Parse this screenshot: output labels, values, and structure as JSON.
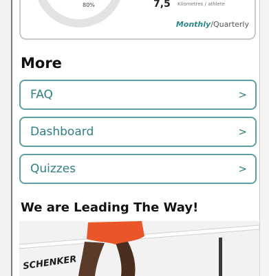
{
  "stats": {
    "ring_percent_label": "80%",
    "value": "7,5",
    "unit": "Kilometres / athlete",
    "period_monthly": "Monthly",
    "period_separator": "/",
    "period_quarterly": "Quarterly"
  },
  "more": {
    "title": "More",
    "items": [
      {
        "label": "FAQ",
        "chevron": ">"
      },
      {
        "label": "Dashboard",
        "chevron": ">"
      },
      {
        "label": "Quizzes",
        "chevron": ">"
      }
    ]
  },
  "leading": {
    "title": "We are Leading The Way!",
    "banner_text": "SCHENKER"
  },
  "colors": {
    "accent": "#2f7f82",
    "border": "#5f9e9e",
    "banner_orange": "#e8562a"
  }
}
